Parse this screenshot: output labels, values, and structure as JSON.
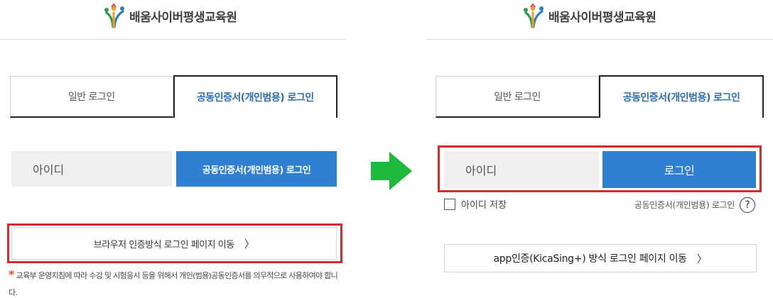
{
  "brand": {
    "name": "배움사이버평생교육원"
  },
  "before": {
    "tabs": [
      {
        "label": "일반 로그인"
      },
      {
        "label": "공동인증서(개인범용) 로그인"
      }
    ],
    "id_label": "아이디",
    "login_button": "공동인증서(개인범용) 로그인",
    "browser_button": "브라우저 인증방식 로그인 페이지 이동",
    "notice_star": "*",
    "notice": "교육부 운영지침에 따라 수강 및 시험응시 등을 위해서 개인(범용)공동인증서를 의무적으로 사용하여야 합니다."
  },
  "after": {
    "tabs": [
      {
        "label": "일반 로그인"
      },
      {
        "label": "공동인증서(개인범용) 로그인"
      }
    ],
    "id_label": "아이디",
    "login_button": "로그인",
    "save_id_label": "아이디 저장",
    "cert_link": "공동인증서(개인범용) 로그인",
    "help_symbol": "?",
    "app_button": "app인증(KicaSing+) 방식 로그인 페이지 이동"
  },
  "chevron": "〉",
  "icons": {
    "logo": "people-logo-icon",
    "arrow": "green-right-arrow-icon",
    "help": "question-circle-icon"
  },
  "colors": {
    "primary": "#2f7fd3",
    "highlight": "#d42b2b",
    "arrow": "#1fba3d",
    "active_tab_text": "#2b6cb0"
  }
}
